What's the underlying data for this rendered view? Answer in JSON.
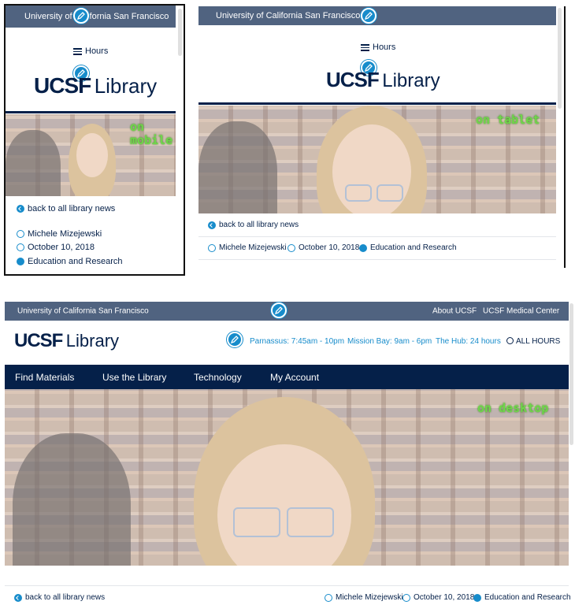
{
  "mobile": {
    "utility_bar": "University of California San Francisco",
    "hours_label": "Hours",
    "logo_ucsf": "UCSF",
    "logo_library": "Library",
    "hero_tag_line1": "on",
    "hero_tag_line2": "mobile",
    "back_link": "back to all library news",
    "author": "Michele Mizejewski",
    "date": "October 10, 2018",
    "category": "Education and Research"
  },
  "tablet": {
    "utility_bar": "University of California San Francisco",
    "hours_label": "Hours",
    "logo_ucsf": "UCSF",
    "logo_library": "Library",
    "hero_tag": "on tablet",
    "back_link": "back to all library news",
    "author": "Michele Mizejewski",
    "date": "October 10, 2018",
    "category": "Education and Research"
  },
  "desktop": {
    "utility_bar": "University of California San Francisco",
    "utility_links": [
      "About UCSF",
      "UCSF Medical Center"
    ],
    "logo_ucsf": "UCSF",
    "logo_library": "Library",
    "hours": {
      "parnassus": "Parnassus: 7:45am - 10pm",
      "mission_bay": "Mission Bay: 9am - 6pm",
      "hub": "The Hub: 24 hours",
      "all_hours": "ALL HOURS"
    },
    "nav": [
      "Find Materials",
      "Use the Library",
      "Technology",
      "My Account"
    ],
    "hero_tag": "on desktop",
    "back_link": "back to all library news",
    "author": "Michele Mizejewski",
    "date": "October 10, 2018",
    "category": "Education and Research"
  },
  "colors": {
    "utility_bar": "#506380",
    "navy": "#052049",
    "accent": "#178ccb",
    "tag_green": "#6fd64a"
  },
  "icons": [
    "pencil-edit-icon",
    "hamburger-icon",
    "back-arrow-icon",
    "user-icon",
    "calendar-icon",
    "book-icon",
    "clock-icon"
  ]
}
